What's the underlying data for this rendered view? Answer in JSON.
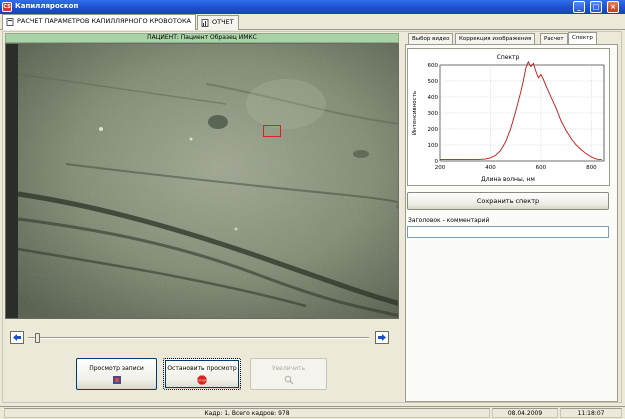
{
  "window": {
    "title": "Капилляроскоп",
    "minimize_label": "_",
    "maximize_label": "□",
    "close_label": "×"
  },
  "top_tabs": [
    {
      "label": "РАСЧЕТ ПАРАМЕТРОВ КАПИЛЛЯРНОГО КРОВОТОКА",
      "icon": "page-icon",
      "active": true
    },
    {
      "label": "ОТЧЕТ",
      "icon": "report-icon",
      "active": false
    }
  ],
  "patient_bar": "ПАЦИЕНТ: Пациент Образец ИМКС",
  "image_marker": {
    "color": "#e0201c"
  },
  "slider": {
    "value": 0.01
  },
  "buttons": {
    "view_record": "Просмотр записи",
    "stop_view": "Остановить просмотр",
    "zoom": "Увеличить"
  },
  "right_tabs": [
    {
      "label": "Выбор видео",
      "active": false
    },
    {
      "label": "Коррекция изображения",
      "active": false
    },
    {
      "label": "Расчет",
      "active": false
    },
    {
      "label": "Спектр",
      "active": true
    }
  ],
  "chart_data": {
    "type": "line",
    "title": "Спектр",
    "xlabel": "Длина волны, нм",
    "ylabel": "Интенсивность",
    "xlim": [
      200,
      850
    ],
    "ylim": [
      0,
      600
    ],
    "xticks": [
      200,
      400,
      600,
      800
    ],
    "yticks": [
      0,
      100,
      200,
      300,
      400,
      500,
      600
    ],
    "grid": true,
    "line_color": "#cc1111",
    "x": [
      200,
      250,
      300,
      350,
      380,
      400,
      420,
      440,
      460,
      480,
      500,
      520,
      530,
      540,
      550,
      560,
      570,
      580,
      590,
      600,
      610,
      620,
      640,
      660,
      680,
      700,
      720,
      740,
      760,
      780,
      800,
      820,
      840
    ],
    "y": [
      10,
      10,
      10,
      10,
      12,
      20,
      35,
      65,
      120,
      200,
      310,
      430,
      500,
      580,
      620,
      590,
      610,
      560,
      520,
      540,
      510,
      470,
      400,
      330,
      250,
      190,
      140,
      100,
      70,
      45,
      25,
      12,
      8
    ]
  },
  "save_spectrum": "Сохранить спектр",
  "comment": {
    "label": "Заголовок - комментарий",
    "value": ""
  },
  "status": {
    "frames": "Кадр: 1, Всего кадров: 978",
    "date": "08.04.2009",
    "time": "11:18:07"
  }
}
